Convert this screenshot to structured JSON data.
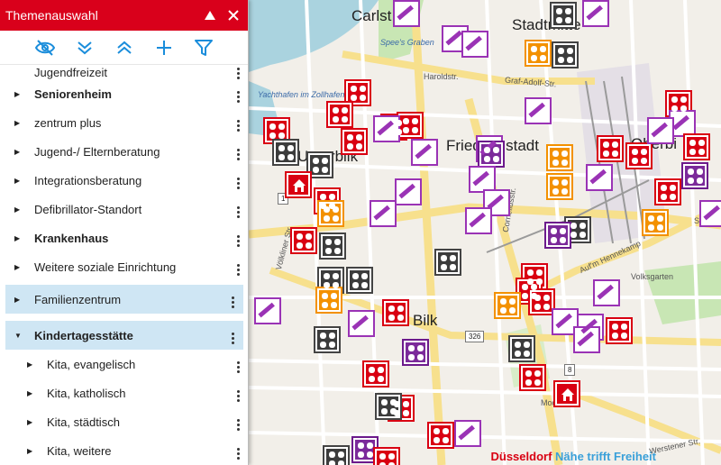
{
  "panel": {
    "title": "Themenauswahl",
    "header_icons": [
      "collapse-up-icon",
      "close-icon"
    ],
    "toolbar": [
      "hide-all-icon",
      "collapse-all-icon",
      "expand-all-icon",
      "add-icon",
      "filter-icon"
    ],
    "rows": [
      {
        "label": "Jugendfreizeit",
        "bold": false,
        "partial": true
      },
      {
        "label": "Seniorenheim",
        "bold": true
      },
      {
        "label": "zentrum plus",
        "bold": false
      },
      {
        "label": "Jugend-/ Elternberatung",
        "bold": false
      },
      {
        "label": "Integrationsberatung",
        "bold": false
      },
      {
        "label": "Defibrillator-Standort",
        "bold": false
      },
      {
        "label": "Krankenhaus",
        "bold": true
      },
      {
        "label": "Weitere soziale Einrichtung",
        "bold": false
      },
      {
        "label": "Familienzentrum",
        "bold": false,
        "highlight": true
      },
      {
        "label": "Kindertagesstätte",
        "bold": true,
        "highlight": true,
        "expanded": true
      },
      {
        "label": "Kita, evangelisch",
        "child": true
      },
      {
        "label": "Kita, katholisch",
        "child": true
      },
      {
        "label": "Kita, städtisch",
        "child": true
      },
      {
        "label": "Kita, weitere",
        "child": true
      }
    ]
  },
  "map": {
    "labels": {
      "carlstadt": "Carlst",
      "stadtmitte": "Stadtmitte",
      "friedrichstadt": "Friedrichstadt",
      "unterbilk": "Unterbilk",
      "bilk": "Bilk",
      "oberbilk": "Oberbi",
      "speesgraben": "Spee's Graben",
      "yachthafen": "Yachthafen im Zollhafen",
      "volkliner": "Völkliner Str.",
      "haroldstr": "Haroldstr.",
      "grafadolf": "Graf-Adolf-Str.",
      "corneliusstr": "Corneliusstr.",
      "aurhennekamp": "Auf'm Hennekamp",
      "volksgarten": "Volksgarten",
      "mooren": "Moorens",
      "werstener": "Werstener Str.",
      "siegburger": "Siegb"
    },
    "road_numbers": [
      "326",
      "8",
      "1"
    ],
    "branding": {
      "city": "Düsseldorf",
      "slogan": "Nähe trifft Freiheit"
    }
  },
  "colors": {
    "header_red": "#d9001b",
    "icon_blue": "#1a8ddb",
    "highlight_blue": "#cfe6f4",
    "marker_red": "#d90012",
    "marker_orange": "#f39100",
    "marker_purple": "#7b2a9a",
    "marker_dark": "#3c3c3c"
  }
}
